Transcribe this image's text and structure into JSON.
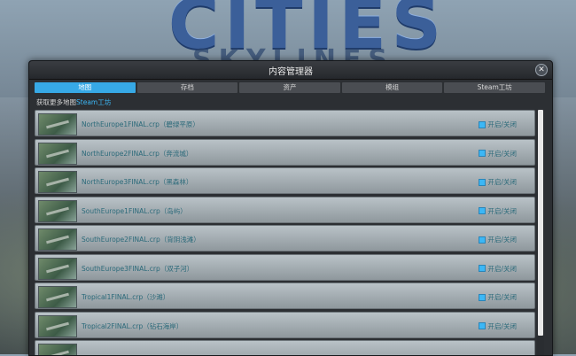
{
  "background": {
    "logo_text": "CITIES",
    "logo_sub": "SKYLINES"
  },
  "window": {
    "title": "内容管理器",
    "close_label": "✕",
    "tabs": [
      "地图",
      "存档",
      "资产",
      "模组",
      "Steam工坊"
    ],
    "active_tab": 0,
    "workshop_prefix": "获取更多地图",
    "workshop_link": "Steam工坊",
    "toggle_label": "开启/关闭",
    "maps": [
      "NorthEurope1FINAL.crp（碧绿平原）",
      "NorthEurope2FINAL.crp（奔流城）",
      "NorthEurope3FINAL.crp（黑森林）",
      "SouthEurope1FINAL.crp（岛屿）",
      "SouthEurope2FINAL.crp（背阴浅滩）",
      "SouthEurope3FINAL.crp（双子河）",
      "Tropical1FINAL.crp（沙滩）",
      "Tropical2FINAL.crp（钻石海岸）"
    ]
  },
  "colors": {
    "accent": "#37a9e6",
    "link": "#3cb7f5"
  }
}
